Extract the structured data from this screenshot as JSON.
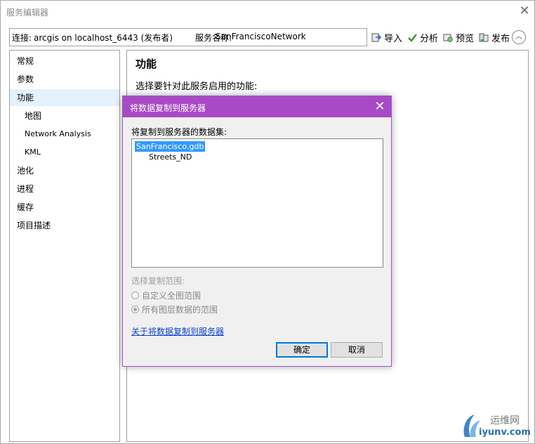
{
  "window": {
    "title": "服务编辑器",
    "close_glyph": "✕"
  },
  "connection": {
    "prefix": "连接:",
    "server": "arcgis on localhost_6443 (发布者)",
    "service_label": "服务名称:",
    "service_name": "SanFranciscoNetwork"
  },
  "toolbar": {
    "import_label": "导入",
    "analyze_label": "分析",
    "preview_label": "预览",
    "publish_label": "发布",
    "collapse_glyph": "︿"
  },
  "sidebar": {
    "items": [
      {
        "label": "常规"
      },
      {
        "label": "参数"
      },
      {
        "label": "功能"
      },
      {
        "label": "地图"
      },
      {
        "label": "Network Analysis"
      },
      {
        "label": "KML"
      },
      {
        "label": "池化"
      },
      {
        "label": "进程"
      },
      {
        "label": "缓存"
      },
      {
        "label": "项目描述"
      }
    ]
  },
  "content": {
    "heading": "功能",
    "description": "选择要针对此服务启用的功能:"
  },
  "dialog": {
    "title": "将数据复制到服务器",
    "close_glyph": "✕",
    "datasets_label": "将复制到服务器的数据集:",
    "tree": {
      "root": "SanFrancisco.gdb",
      "child": "Streets_ND"
    },
    "range_label": "选择复制范围:",
    "options": [
      {
        "label": "自定义全图范围"
      },
      {
        "label": "所有图层数据的范围"
      }
    ],
    "help_link": "关于将数据复制到服务器",
    "ok_label": "确定",
    "cancel_label": "取消"
  },
  "watermark": {
    "line1": "运维网",
    "line2": "iyunv.com"
  },
  "colors": {
    "dialog_title_bg": "#a84ac4",
    "selection_bg": "#3399ff",
    "link": "#0b3fd1",
    "nav_selected_bg": "#e5f1fb"
  }
}
